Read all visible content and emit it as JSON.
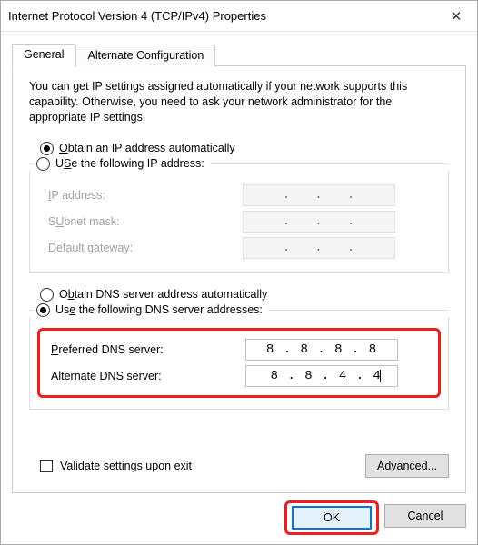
{
  "window": {
    "title": "Internet Protocol Version 4 (TCP/IPv4) Properties"
  },
  "tabs": {
    "general": "General",
    "alternate": "Alternate Configuration"
  },
  "intro": "You can get IP settings assigned automatically if your network supports this capability. Otherwise, you need to ask your network administrator for the appropriate IP settings.",
  "ip": {
    "auto_label_pre": "O",
    "auto_label_rest": "btain an IP address automatically",
    "manual_label_pre": "Use the following IP address:",
    "manual_underline": "S",
    "fields": {
      "ip_label_pre": "I",
      "ip_label_rest": "P address:",
      "subnet_label_pre": "Subnet mask:",
      "subnet_underline": "U",
      "gateway_label_pre": "D",
      "gateway_label_rest": "efault gateway:"
    }
  },
  "dns": {
    "auto_label_pre": "Obtain DNS server address automatically",
    "auto_underline": "b",
    "manual_label": "Use the following DNS server addresses:",
    "manual_underline": "e",
    "preferred_label": "Preferred DNS server:",
    "preferred_underline": "P",
    "alternate_label": "Alternate DNS server:",
    "alternate_underline": "A",
    "preferred_value": " 8 . 8 . 8 . 8 ",
    "alternate_value": " 8 . 8 . 4 . 4"
  },
  "validate": {
    "label": "Validate settings upon exit",
    "underline": "l"
  },
  "buttons": {
    "advanced": "Advanced...",
    "ok": "OK",
    "cancel": "Cancel"
  }
}
